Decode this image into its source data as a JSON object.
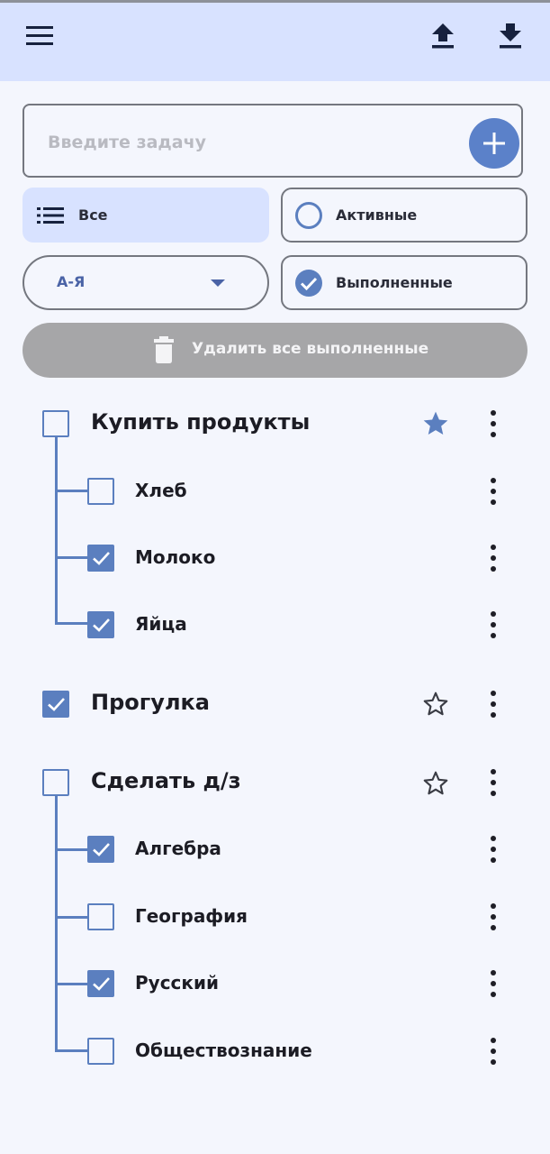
{
  "colors": {
    "appbar": "#d8e2ff",
    "accent": "#5b7fbf",
    "fab": "#5b81c9",
    "delete_disabled": "#a6a6a8",
    "background": "#f4f6fd"
  },
  "toolbar": {
    "menu_icon": "hamburger-menu-icon",
    "upload_icon": "upload-icon",
    "download_icon": "download-icon"
  },
  "input": {
    "placeholder": "Введите задачу",
    "value": "",
    "add_icon": "plus-icon"
  },
  "filters": {
    "all": {
      "label": "Все",
      "icon": "list-icon",
      "selected": true
    },
    "active": {
      "label": "Активные",
      "icon": "radio-empty-icon",
      "selected": false
    },
    "completed": {
      "label": "Выполненные",
      "icon": "check-circle-icon",
      "selected": false
    }
  },
  "sort": {
    "value": "А-Я",
    "icon": "dropdown-caret-icon"
  },
  "delete_completed": {
    "label": "Удалить все выполненные",
    "icon": "trash-icon",
    "enabled": false
  },
  "tasks": [
    {
      "title": "Купить продукты",
      "checked": false,
      "starred": true,
      "subtasks": [
        {
          "title": "Хлеб",
          "checked": false
        },
        {
          "title": "Молоко",
          "checked": true
        },
        {
          "title": "Яйца",
          "checked": true
        }
      ]
    },
    {
      "title": "Прогулка",
      "checked": true,
      "starred": false,
      "subtasks": []
    },
    {
      "title": "Сделать д/з",
      "checked": false,
      "starred": false,
      "subtasks": [
        {
          "title": "Алгебра",
          "checked": true
        },
        {
          "title": "География",
          "checked": false
        },
        {
          "title": "Русский",
          "checked": true
        },
        {
          "title": "Обществознание",
          "checked": false
        }
      ]
    }
  ]
}
